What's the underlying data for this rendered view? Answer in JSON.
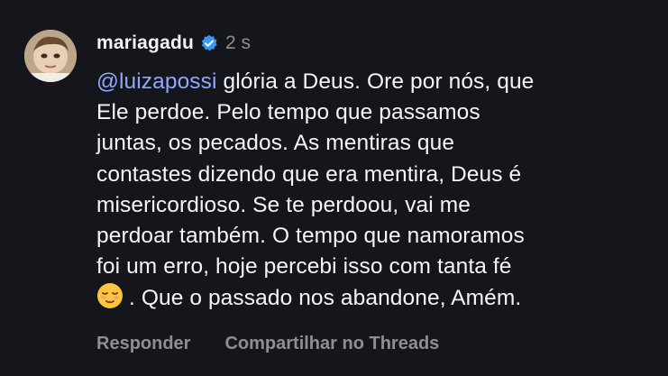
{
  "comment": {
    "username": "mariagadu",
    "time": "2 s",
    "mention": "@luizapossi",
    "lines": [
      " glória a Deus.  Ore por nós, que",
      "Ele perdoe. Pelo tempo que passamos",
      "juntas, os pecados. As mentiras que",
      "contastes dizendo que era mentira, Deus é",
      "misericordioso. Se te perdoou, vai me",
      "perdoar também. O tempo que namoramos",
      "foi um erro, hoje percebi isso com tanta fé",
      ". Que o passado nos abandone,  Amém."
    ],
    "emoji": "relieved-face-emoji"
  },
  "actions": {
    "reply_label": "Responder",
    "share_label": "Compartilhar no Threads"
  },
  "colors": {
    "background": "#15151c",
    "mention": "#8fa8ff",
    "verified": "#3897f0",
    "muted": "#8e8e93"
  }
}
